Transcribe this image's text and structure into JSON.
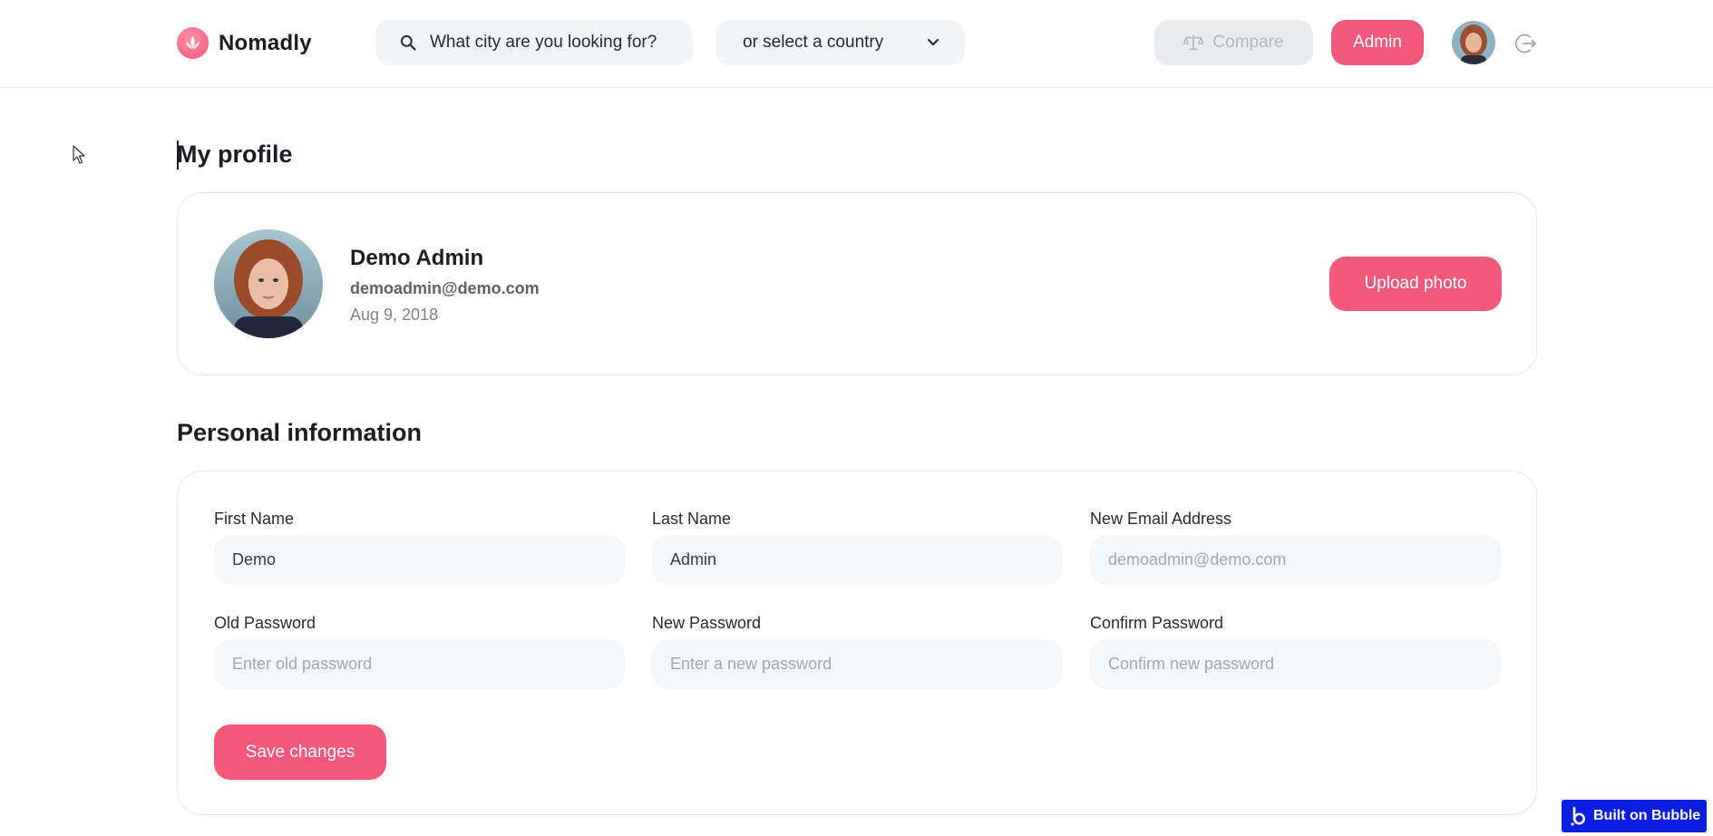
{
  "app": {
    "name": "Nomadly"
  },
  "header": {
    "search_placeholder": "What city are you looking for?",
    "country_select": "or select a country",
    "compare_label": "Compare",
    "admin_label": "Admin"
  },
  "profile": {
    "title": "My profile",
    "name": "Demo Admin",
    "email": "demoadmin@demo.com",
    "joined": "Aug 9, 2018",
    "upload_label": "Upload photo"
  },
  "personal": {
    "title": "Personal information",
    "first_name": {
      "label": "First Name",
      "value": "Demo"
    },
    "last_name": {
      "label": "Last Name",
      "value": "Admin"
    },
    "new_email": {
      "label": "New Email Address",
      "placeholder": "demoadmin@demo.com"
    },
    "old_password": {
      "label": "Old Password",
      "placeholder": "Enter old password"
    },
    "new_password": {
      "label": "New Password",
      "placeholder": "Enter a new password"
    },
    "confirm_password": {
      "label": "Confirm Password",
      "placeholder": "Confirm new password"
    },
    "save_label": "Save changes"
  },
  "badge": {
    "label": "Built on Bubble"
  },
  "colors": {
    "accent": "#f5587d",
    "badge": "#0c1ee0"
  }
}
